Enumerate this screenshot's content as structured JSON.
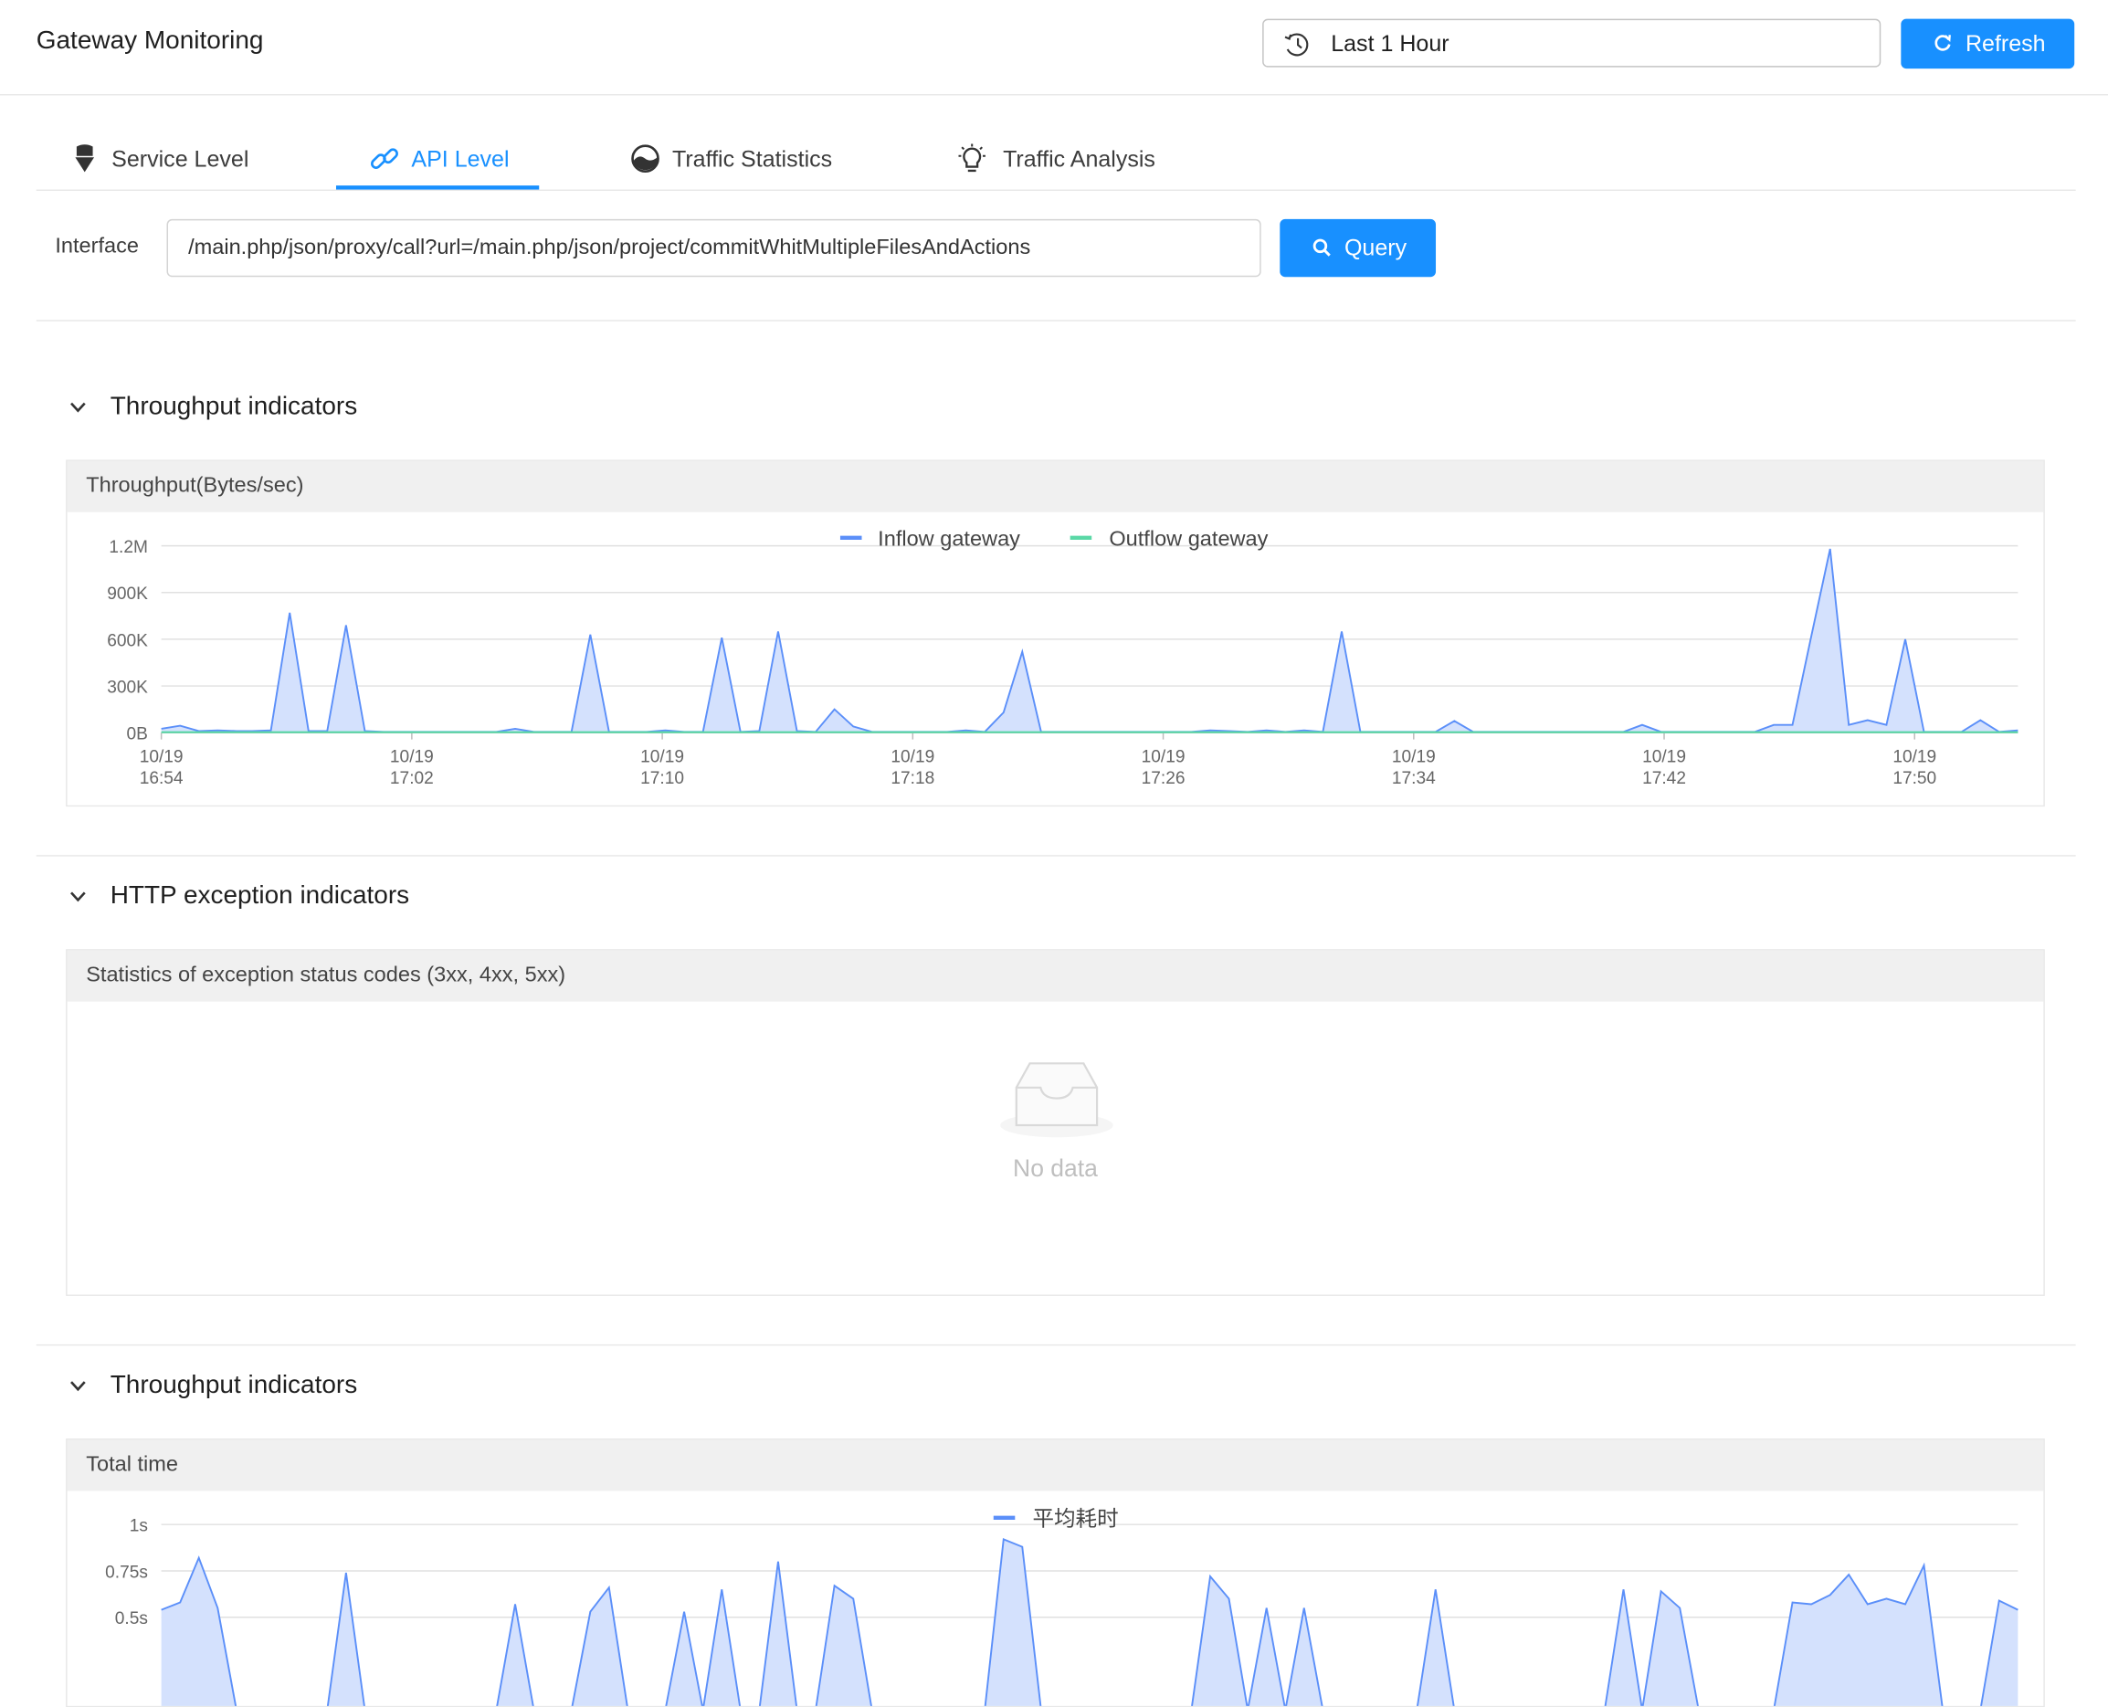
{
  "header": {
    "title": "Gateway Monitoring",
    "time_range": "Last 1 Hour",
    "refresh_label": "Refresh",
    "time_icon": "history-clock-icon",
    "refresh_icon": "refresh-icon"
  },
  "tabs": [
    {
      "label": "Service Level",
      "icon": "service-icon",
      "active": false
    },
    {
      "label": "API Level",
      "icon": "link-icon",
      "active": true
    },
    {
      "label": "Traffic Statistics",
      "icon": "dashboard-icon",
      "active": false
    },
    {
      "label": "Traffic Analysis",
      "icon": "bulb-icon",
      "active": false
    }
  ],
  "query": {
    "label": "Interface",
    "value": "/main.php/json/proxy/call?url=/main.php/json/project/commitWhitMultipleFilesAndActions",
    "button_label": "Query",
    "button_icon": "search-icon"
  },
  "sections": [
    {
      "title": "Throughput indicators",
      "card_title": "Throughput(Bytes/sec)"
    },
    {
      "title": "HTTP exception indicators",
      "card_title": "Statistics of exception status codes (3xx, 4xx, 5xx)",
      "empty_text": "No data"
    },
    {
      "title": "Throughput indicators",
      "card_title": "Total time"
    }
  ],
  "colors": {
    "primary": "#1890ff",
    "inflow": "#5b8ff9",
    "inflow_fill": "#d4e1fd",
    "outflow": "#5ad8a6"
  },
  "chart_data": [
    {
      "type": "area",
      "title": "Throughput(Bytes/sec)",
      "ylim": [
        0,
        1200000
      ],
      "y_ticks": [
        "0B",
        "300K",
        "600K",
        "900K",
        "1.2M"
      ],
      "x_ticks": [
        "10/19\n16:54",
        "10/19\n17:02",
        "10/19\n17:10",
        "10/19\n17:18",
        "10/19\n17:26",
        "10/19\n17:34",
        "10/19\n17:42",
        "10/19\n17:50"
      ],
      "x_start": "16:54",
      "x_end": "17:53",
      "legend": [
        "Inflow gateway",
        "Outflow gateway"
      ],
      "legend_position": "top",
      "grid": true,
      "series": [
        {
          "name": "Inflow gateway",
          "values": [
            [
              0,
              25000
            ],
            [
              0.6,
              45000
            ],
            [
              1.2,
              10000
            ],
            [
              1.8,
              15000
            ],
            [
              2.4,
              10000
            ],
            [
              2.9,
              10000
            ],
            [
              3.5,
              15000
            ],
            [
              4.1,
              770000
            ],
            [
              4.7,
              10000
            ],
            [
              5.3,
              10000
            ],
            [
              5.9,
              690000
            ],
            [
              6.5,
              10000
            ],
            [
              7.1,
              5000
            ],
            [
              7.7,
              5000
            ],
            [
              8.3,
              5000
            ],
            [
              8.9,
              5000
            ],
            [
              9.5,
              5000
            ],
            [
              10.1,
              5000
            ],
            [
              10.7,
              5000
            ],
            [
              11.3,
              25000
            ],
            [
              11.9,
              5000
            ],
            [
              12.5,
              5000
            ],
            [
              13.1,
              5000
            ],
            [
              13.7,
              630000
            ],
            [
              14.3,
              5000
            ],
            [
              14.9,
              5000
            ],
            [
              15.5,
              5000
            ],
            [
              16.1,
              15000
            ],
            [
              16.7,
              5000
            ],
            [
              17.3,
              5000
            ],
            [
              17.9,
              610000
            ],
            [
              18.5,
              5000
            ],
            [
              19.1,
              10000
            ],
            [
              19.7,
              650000
            ],
            [
              20.3,
              10000
            ],
            [
              20.9,
              5000
            ],
            [
              21.5,
              150000
            ],
            [
              22.1,
              40000
            ],
            [
              22.7,
              5000
            ],
            [
              23.3,
              5000
            ],
            [
              23.9,
              5000
            ],
            [
              24.5,
              5000
            ],
            [
              25.1,
              5000
            ],
            [
              25.7,
              15000
            ],
            [
              26.3,
              5000
            ],
            [
              26.9,
              130000
            ],
            [
              27.5,
              520000
            ],
            [
              28.1,
              5000
            ],
            [
              28.7,
              5000
            ],
            [
              29.3,
              5000
            ],
            [
              29.9,
              5000
            ],
            [
              30.5,
              5000
            ],
            [
              31.1,
              5000
            ],
            [
              31.7,
              5000
            ],
            [
              32.3,
              5000
            ],
            [
              32.9,
              5000
            ],
            [
              33.5,
              15000
            ],
            [
              34.1,
              10000
            ],
            [
              34.7,
              5000
            ],
            [
              35.3,
              15000
            ],
            [
              35.9,
              5000
            ],
            [
              36.5,
              15000
            ],
            [
              37.1,
              5000
            ],
            [
              37.7,
              650000
            ],
            [
              38.3,
              5000
            ],
            [
              38.9,
              5000
            ],
            [
              39.5,
              5000
            ],
            [
              40.1,
              5000
            ],
            [
              40.7,
              5000
            ],
            [
              41.3,
              75000
            ],
            [
              41.9,
              5000
            ],
            [
              42.5,
              5000
            ],
            [
              43.1,
              5000
            ],
            [
              43.7,
              5000
            ],
            [
              44.3,
              5000
            ],
            [
              44.9,
              5000
            ],
            [
              45.5,
              5000
            ],
            [
              46.1,
              5000
            ],
            [
              46.7,
              5000
            ],
            [
              47.3,
              50000
            ],
            [
              47.9,
              5000
            ],
            [
              48.5,
              5000
            ],
            [
              49.1,
              5000
            ],
            [
              49.7,
              5000
            ],
            [
              50.3,
              5000
            ],
            [
              50.9,
              5000
            ],
            [
              51.5,
              50000
            ],
            [
              52.1,
              50000
            ],
            [
              52.7,
              620000
            ],
            [
              53.3,
              1180000
            ],
            [
              53.9,
              50000
            ],
            [
              54.5,
              80000
            ],
            [
              55.1,
              50000
            ],
            [
              55.7,
              600000
            ],
            [
              56.3,
              5000
            ],
            [
              56.9,
              5000
            ],
            [
              57.5,
              5000
            ],
            [
              58.1,
              80000
            ],
            [
              58.7,
              5000
            ],
            [
              59.3,
              15000
            ]
          ]
        },
        {
          "name": "Outflow gateway",
          "values": [
            [
              0,
              3000
            ],
            [
              59.3,
              3000
            ]
          ]
        }
      ]
    },
    {
      "type": "area",
      "title": "Total time",
      "ylim": [
        0,
        1
      ],
      "y_ticks": [
        "0.5s",
        "0.75s",
        "1s"
      ],
      "legend": [
        "平均耗时"
      ],
      "legend_position": "top",
      "grid": true,
      "series": [
        {
          "name": "平均耗时",
          "values": [
            [
              0,
              0.54
            ],
            [
              0.6,
              0.58
            ],
            [
              1.2,
              0.82
            ],
            [
              1.8,
              0.55
            ],
            [
              2.4,
              0.0
            ],
            [
              2.9,
              0.0
            ],
            [
              3.5,
              0.0
            ],
            [
              4.1,
              0.0
            ],
            [
              4.7,
              0.0
            ],
            [
              5.3,
              0.0
            ],
            [
              5.9,
              0.74
            ],
            [
              6.5,
              0.0
            ],
            [
              7.1,
              0.0
            ],
            [
              7.7,
              0.0
            ],
            [
              8.3,
              0.0
            ],
            [
              8.9,
              0.0
            ],
            [
              9.5,
              0.0
            ],
            [
              10.1,
              0.0
            ],
            [
              10.7,
              0.0
            ],
            [
              11.3,
              0.57
            ],
            [
              11.9,
              0.0
            ],
            [
              12.5,
              0.0
            ],
            [
              13.1,
              0.0
            ],
            [
              13.7,
              0.53
            ],
            [
              14.3,
              0.66
            ],
            [
              14.9,
              0.0
            ],
            [
              15.5,
              0.0
            ],
            [
              16.1,
              0.0
            ],
            [
              16.7,
              0.53
            ],
            [
              17.3,
              0.0
            ],
            [
              17.9,
              0.65
            ],
            [
              18.5,
              0.0
            ],
            [
              19.1,
              0.0
            ],
            [
              19.7,
              0.8
            ],
            [
              20.3,
              0.0
            ],
            [
              20.9,
              0.0
            ],
            [
              21.5,
              0.67
            ],
            [
              22.1,
              0.6
            ],
            [
              22.7,
              0.0
            ],
            [
              23.3,
              0.0
            ],
            [
              23.9,
              0.0
            ],
            [
              24.5,
              0.0
            ],
            [
              25.1,
              0.0
            ],
            [
              25.7,
              0.0
            ],
            [
              26.3,
              0.0
            ],
            [
              26.9,
              0.92
            ],
            [
              27.5,
              0.88
            ],
            [
              28.1,
              0.0
            ],
            [
              28.7,
              0.0
            ],
            [
              29.3,
              0.0
            ],
            [
              29.9,
              0.0
            ],
            [
              30.5,
              0.0
            ],
            [
              31.1,
              0.0
            ],
            [
              31.7,
              0.0
            ],
            [
              32.3,
              0.0
            ],
            [
              32.9,
              0.0
            ],
            [
              33.5,
              0.72
            ],
            [
              34.1,
              0.6
            ],
            [
              34.7,
              0.0
            ],
            [
              35.3,
              0.55
            ],
            [
              35.9,
              0.0
            ],
            [
              36.5,
              0.55
            ],
            [
              37.1,
              0.0
            ],
            [
              37.7,
              0.0
            ],
            [
              38.3,
              0.0
            ],
            [
              38.9,
              0.0
            ],
            [
              39.5,
              0.0
            ],
            [
              40.1,
              0.0
            ],
            [
              40.7,
              0.65
            ],
            [
              41.3,
              0.0
            ],
            [
              41.9,
              0.0
            ],
            [
              42.5,
              0.0
            ],
            [
              43.1,
              0.0
            ],
            [
              43.7,
              0.0
            ],
            [
              44.3,
              0.0
            ],
            [
              44.9,
              0.0
            ],
            [
              45.5,
              0.0
            ],
            [
              46.1,
              0.0
            ],
            [
              46.7,
              0.65
            ],
            [
              47.3,
              0.0
            ],
            [
              47.9,
              0.64
            ],
            [
              48.5,
              0.55
            ],
            [
              49.1,
              0.0
            ],
            [
              49.7,
              0.0
            ],
            [
              50.3,
              0.0
            ],
            [
              50.9,
              0.0
            ],
            [
              51.5,
              0.0
            ],
            [
              52.1,
              0.58
            ],
            [
              52.7,
              0.57
            ],
            [
              53.3,
              0.62
            ],
            [
              53.9,
              0.73
            ],
            [
              54.5,
              0.57
            ],
            [
              55.1,
              0.6
            ],
            [
              55.7,
              0.57
            ],
            [
              56.3,
              0.78
            ],
            [
              56.9,
              0.0
            ],
            [
              57.5,
              0.0
            ],
            [
              58.1,
              0.0
            ],
            [
              58.7,
              0.59
            ],
            [
              59.3,
              0.54
            ]
          ]
        }
      ]
    }
  ]
}
